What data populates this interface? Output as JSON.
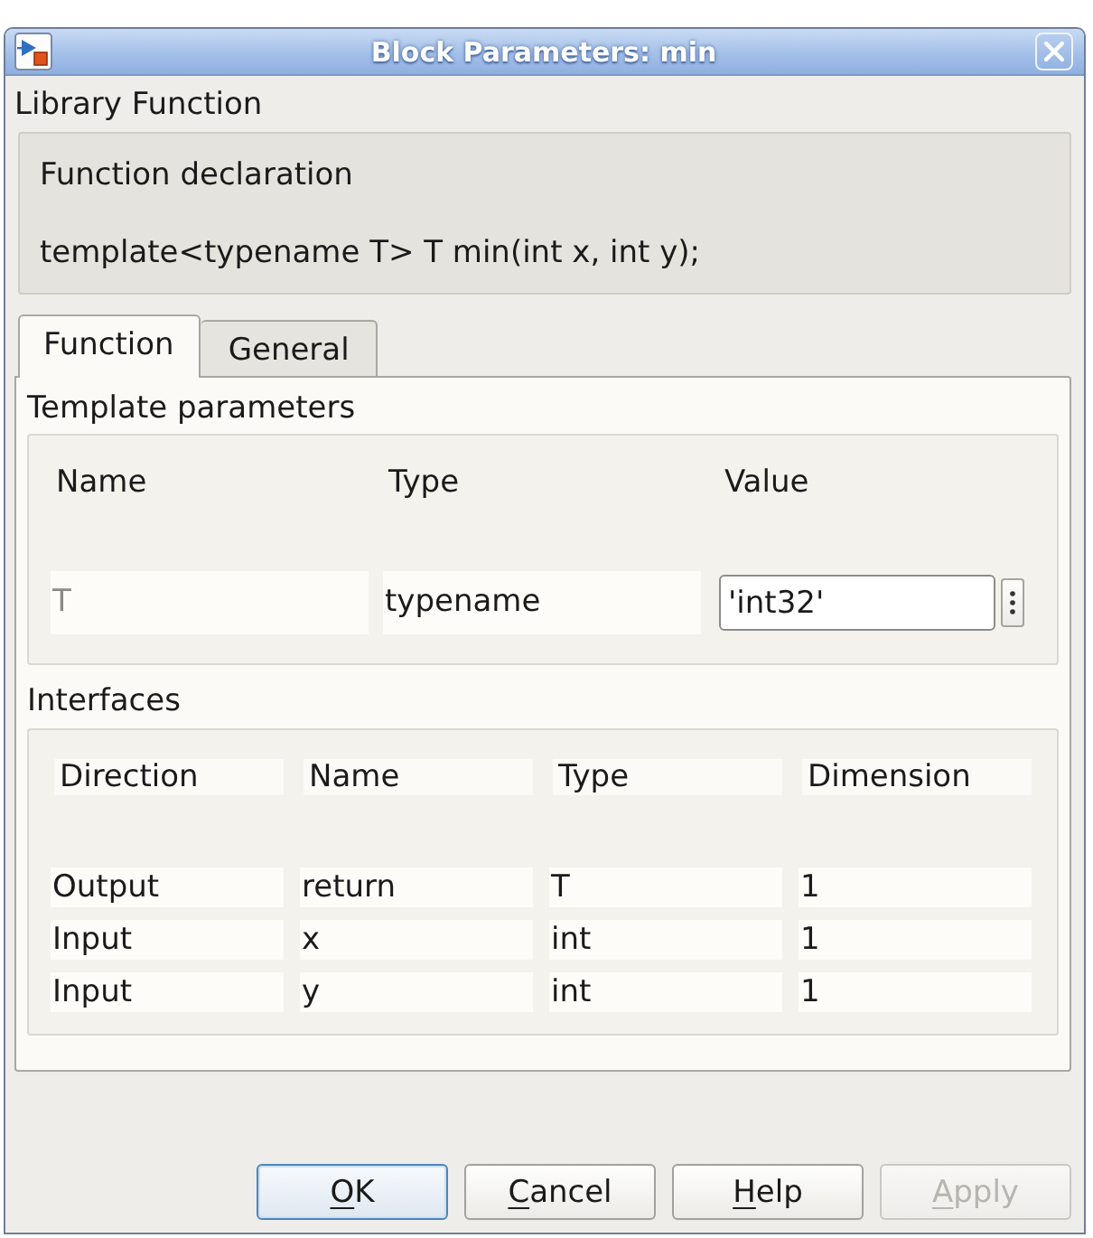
{
  "window": {
    "title": "Block Parameters: min"
  },
  "library_function": {
    "label": "Library Function",
    "heading": "Function declaration",
    "declaration": "template<typename T> T min(int x, int y);"
  },
  "tabs": [
    {
      "label": "Function",
      "selected": true
    },
    {
      "label": "General",
      "selected": false
    }
  ],
  "template_parameters": {
    "label": "Template parameters",
    "columns": [
      "Name",
      "Type",
      "Value"
    ],
    "rows": [
      {
        "name": "T",
        "name_disabled": true,
        "type": "typename",
        "value": "'int32'"
      }
    ]
  },
  "interfaces": {
    "label": "Interfaces",
    "columns": [
      "Direction",
      "Name",
      "Type",
      "Dimension"
    ],
    "rows": [
      {
        "direction": "Output",
        "name": "return",
        "type": "T",
        "dimension": "1"
      },
      {
        "direction": "Input",
        "name": "x",
        "type": "int",
        "dimension": "1"
      },
      {
        "direction": "Input",
        "name": "y",
        "type": "int",
        "dimension": "1"
      }
    ]
  },
  "buttons": [
    {
      "label": "OK",
      "default": true,
      "disabled": false,
      "mnemonic_underline": true
    },
    {
      "label": "Cancel",
      "default": false,
      "disabled": false,
      "mnemonic_underline": true
    },
    {
      "label": "Help",
      "default": false,
      "disabled": false,
      "mnemonic_underline": true
    },
    {
      "label": "Apply",
      "default": false,
      "disabled": true,
      "mnemonic_underline": true
    }
  ]
}
